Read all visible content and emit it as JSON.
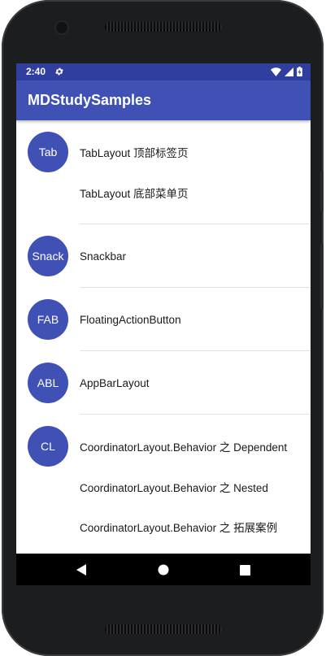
{
  "status_bar": {
    "time": "2:40",
    "settings_icon": "gear-icon",
    "wifi_icon": "wifi-icon",
    "signal_icon": "cell-signal-icon",
    "battery_icon": "battery-charging-icon"
  },
  "app_bar": {
    "title": "MDStudySamples",
    "color": "#3f51b5",
    "status_color": "#303f9f"
  },
  "groups": [
    {
      "avatar": "Tab",
      "items": [
        "TabLayout 顶部标签页",
        "TabLayout 底部菜单页"
      ]
    },
    {
      "avatar": "Snack",
      "items": [
        "Snackbar"
      ]
    },
    {
      "avatar": "FAB",
      "items": [
        "FloatingActionButton"
      ]
    },
    {
      "avatar": "ABL",
      "items": [
        "AppBarLayout"
      ]
    },
    {
      "avatar": "CL",
      "items": [
        "CoordinatorLayout.Behavior 之 Dependent",
        "CoordinatorLayout.Behavior 之 Nested",
        "CoordinatorLayout.Behavior 之 拓展案例"
      ]
    }
  ],
  "nav_bar": {
    "back_icon": "back-triangle-icon",
    "home_icon": "home-circle-icon",
    "recents_icon": "recents-square-icon"
  }
}
